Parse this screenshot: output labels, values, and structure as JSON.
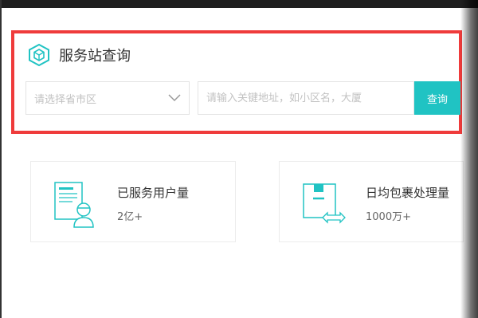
{
  "query_card": {
    "title": "服务站查询",
    "region_select": {
      "placeholder": "请选择省市区"
    },
    "address_input": {
      "placeholder": "请输入关键地址，如小区名，大厦"
    },
    "search_button": "查询"
  },
  "stats": [
    {
      "label": "已服务用户量",
      "value": "2亿+",
      "icon": "user-document-icon"
    },
    {
      "label": "日均包裹处理量",
      "value": "1000万+",
      "icon": "package-icon"
    }
  ],
  "colors": {
    "accent": "#20c3c3",
    "highlight_border": "#ef3b3b"
  }
}
